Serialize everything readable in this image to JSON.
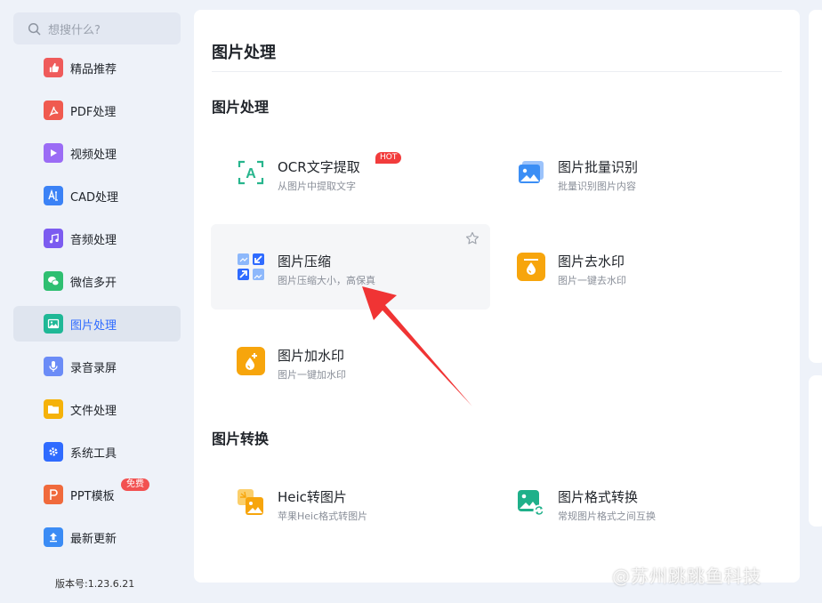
{
  "search": {
    "placeholder": "想搜什么?"
  },
  "sidebar": {
    "items": [
      {
        "label": "精品推荐",
        "icon": "thumbs-up-icon",
        "color": "#ef5b5b"
      },
      {
        "label": "PDF处理",
        "icon": "pdf-icon",
        "color": "#f05a4f"
      },
      {
        "label": "视频处理",
        "icon": "play-icon",
        "color": "#9b6cf5"
      },
      {
        "label": "CAD处理",
        "icon": "cad-icon",
        "color": "#3b82f6"
      },
      {
        "label": "音频处理",
        "icon": "music-icon",
        "color": "#7c5cf0"
      },
      {
        "label": "微信多开",
        "icon": "wechat-icon",
        "color": "#2fbf71"
      },
      {
        "label": "图片处理",
        "icon": "image-icon",
        "color": "#1fb896",
        "active": true
      },
      {
        "label": "录音录屏",
        "icon": "microphone-icon",
        "color": "#6b8cf7"
      },
      {
        "label": "文件处理",
        "icon": "folder-icon",
        "color": "#f5b20a"
      },
      {
        "label": "系统工具",
        "icon": "gear-icon",
        "color": "#2f6bff"
      },
      {
        "label": "PPT模板",
        "icon": "ppt-icon",
        "color": "#f06a3c",
        "badge": "免费"
      },
      {
        "label": "最新更新",
        "icon": "upload-icon",
        "color": "#3b8cf5"
      }
    ],
    "version": "版本号:1.23.6.21"
  },
  "main": {
    "title": "图片处理",
    "sections": [
      {
        "title": "图片处理",
        "tools": [
          {
            "name": "OCR文字提取",
            "desc": "从图片中提取文字",
            "icon": "ocr-icon",
            "hot": "HOT"
          },
          {
            "name": "图片批量识别",
            "desc": "批量识别图片内容",
            "icon": "image-batch-icon"
          },
          {
            "name": "图片压缩",
            "desc": "图片压缩大小，高保真",
            "icon": "compress-icon"
          },
          {
            "name": "图片去水印",
            "desc": "图片一键去水印",
            "icon": "remove-watermark-icon"
          },
          {
            "name": "图片加水印",
            "desc": "图片一键加水印",
            "icon": "add-watermark-icon"
          }
        ]
      },
      {
        "title": "图片转换",
        "tools": [
          {
            "name": "Heic转图片",
            "desc": "苹果Heic格式转图片",
            "icon": "heic-convert-icon"
          },
          {
            "name": "图片格式转换",
            "desc": "常规图片格式之间互换",
            "icon": "format-convert-icon"
          }
        ]
      }
    ]
  },
  "watermark": "@苏州跳跳鱼科技",
  "colors": {
    "accent": "#2f6bff",
    "arrow": "#f03434",
    "hot": "#f23c3c"
  }
}
